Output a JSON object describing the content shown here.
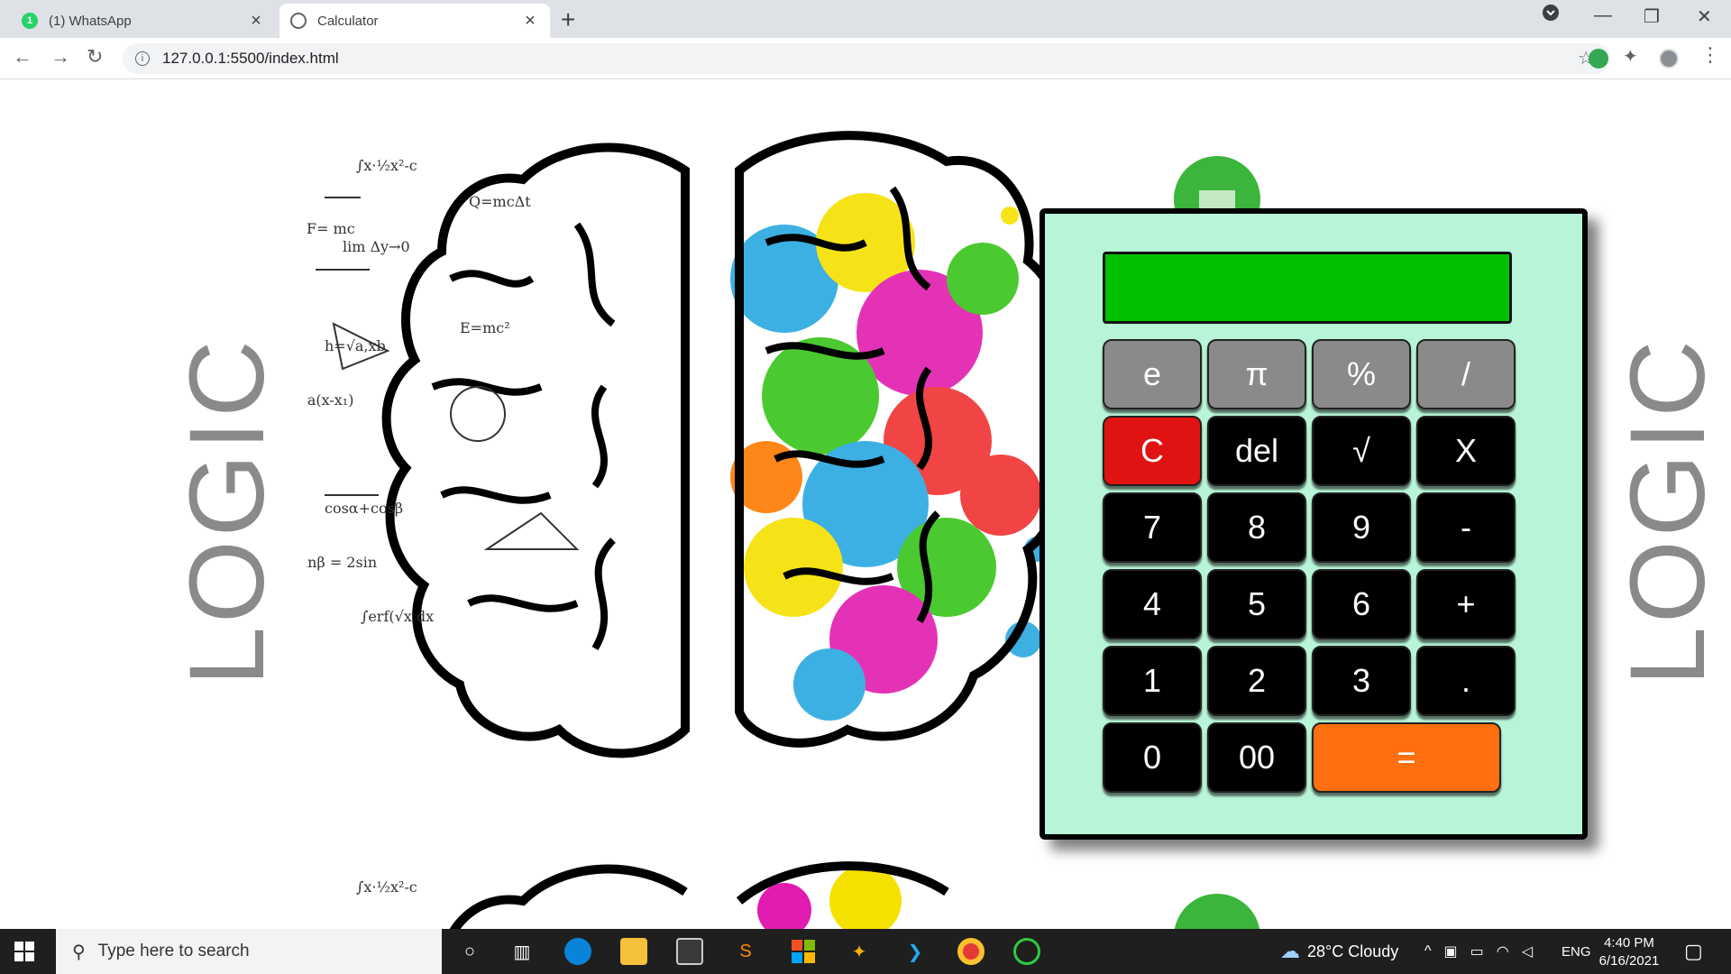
{
  "browser": {
    "tabs": [
      {
        "title": "(1) WhatsApp",
        "badge": "1",
        "active": false
      },
      {
        "title": "Calculator",
        "active": true
      }
    ],
    "new_tab": "+",
    "close": "×",
    "url": "127.0.0.1:5500/index.html",
    "controls": {
      "minimize": "—",
      "restore": "❐",
      "close": "✕"
    }
  },
  "page": {
    "side_text_left": "LOGIC",
    "side_text_right": "LOGIC",
    "calculator": {
      "display_value": "",
      "keys": [
        {
          "label": "e",
          "style": "gray"
        },
        {
          "label": "π",
          "style": "gray"
        },
        {
          "label": "%",
          "style": "gray"
        },
        {
          "label": "/",
          "style": "gray"
        },
        {
          "label": "C",
          "style": "red"
        },
        {
          "label": "del",
          "style": "black"
        },
        {
          "label": "√",
          "style": "black"
        },
        {
          "label": "X",
          "style": "black"
        },
        {
          "label": "7",
          "style": "black"
        },
        {
          "label": "8",
          "style": "black"
        },
        {
          "label": "9",
          "style": "black"
        },
        {
          "label": "-",
          "style": "black"
        },
        {
          "label": "4",
          "style": "black"
        },
        {
          "label": "5",
          "style": "black"
        },
        {
          "label": "6",
          "style": "black"
        },
        {
          "label": "+",
          "style": "black"
        },
        {
          "label": "1",
          "style": "black"
        },
        {
          "label": "2",
          "style": "black"
        },
        {
          "label": "3",
          "style": "black"
        },
        {
          "label": ".",
          "style": "black"
        },
        {
          "label": "0",
          "style": "black"
        },
        {
          "label": "00",
          "style": "black"
        },
        {
          "label": "=",
          "style": "orange"
        }
      ],
      "colors": {
        "body": "#b8f5d8",
        "display": "#00c000",
        "equals": "#ff6f0f",
        "clear": "#e11212",
        "func": "#8a8a8a"
      }
    }
  },
  "taskbar": {
    "search_placeholder": "Type here to search",
    "weather": "28°C  Cloudy",
    "language": "ENG",
    "time": "4:40 PM",
    "date": "6/16/2021"
  }
}
